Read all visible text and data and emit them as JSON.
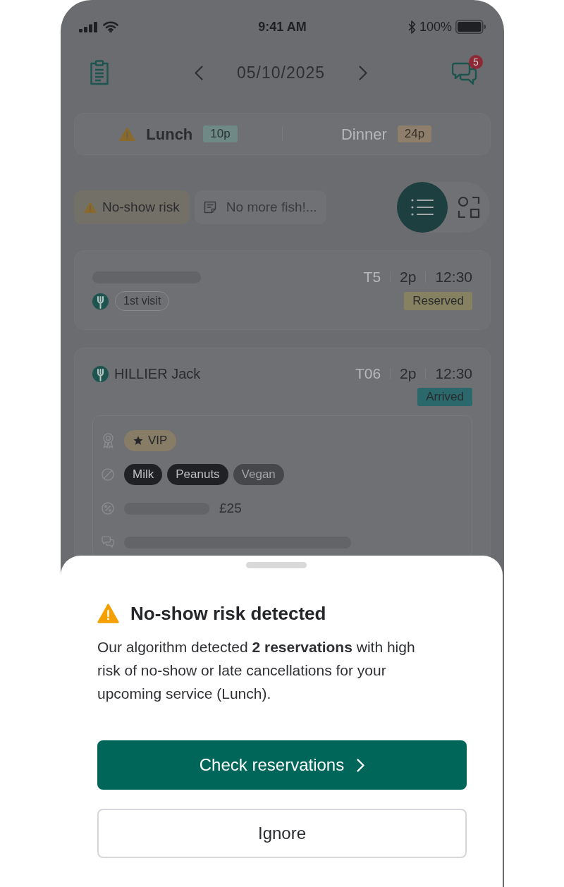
{
  "status_bar": {
    "time": "9:41 AM",
    "battery": "100%"
  },
  "header": {
    "date": "05/10/2025",
    "unread_messages": "5"
  },
  "services": [
    {
      "name": "Lunch",
      "covers": "10p",
      "color": "#6f8986",
      "selected": true,
      "warning": true
    },
    {
      "name": "Dinner",
      "covers": "24p",
      "color": "#8e7e6c",
      "selected": false,
      "warning": false
    }
  ],
  "filters": [
    {
      "kind": "warning",
      "label": "No-show risk"
    },
    {
      "kind": "note",
      "label": "No more fish!..."
    }
  ],
  "view_toggle": [
    {
      "kind": "list",
      "selected": true
    },
    {
      "kind": "floor_plan",
      "selected": false
    }
  ],
  "reservations": [
    {
      "table": "T5",
      "covers": "2p",
      "time": "12:30",
      "status": {
        "label": "Reserved",
        "color": "#858161"
      },
      "tags": [
        "1st visit"
      ],
      "expanded": false
    },
    {
      "name": "HILLIER Jack",
      "table": "T06",
      "covers": "2p",
      "time": "12:30",
      "status": {
        "label": "Arrived",
        "color": "#2a686b"
      },
      "expanded": true,
      "details": [
        {
          "kind": "vip",
          "tags": [
            {
              "label": "VIP",
              "kind": "vip"
            }
          ]
        },
        {
          "kind": "diet",
          "tags": [
            {
              "label": "Milk",
              "kind": "allergy"
            },
            {
              "label": "Peanuts",
              "kind": "allergy"
            },
            {
              "label": "Vegan",
              "kind": "preference"
            }
          ]
        },
        {
          "kind": "discount",
          "amount": "£25"
        },
        {
          "kind": "comment"
        }
      ]
    }
  ],
  "bottom_sheet": {
    "title": "No-show risk detected",
    "message": "Our algorithm detected **2 reservations** with high risk of no-show or late cancellations for your upcoming service (Lunch).",
    "primary_button": "Check reservations",
    "secondary_button": "Ignore"
  }
}
